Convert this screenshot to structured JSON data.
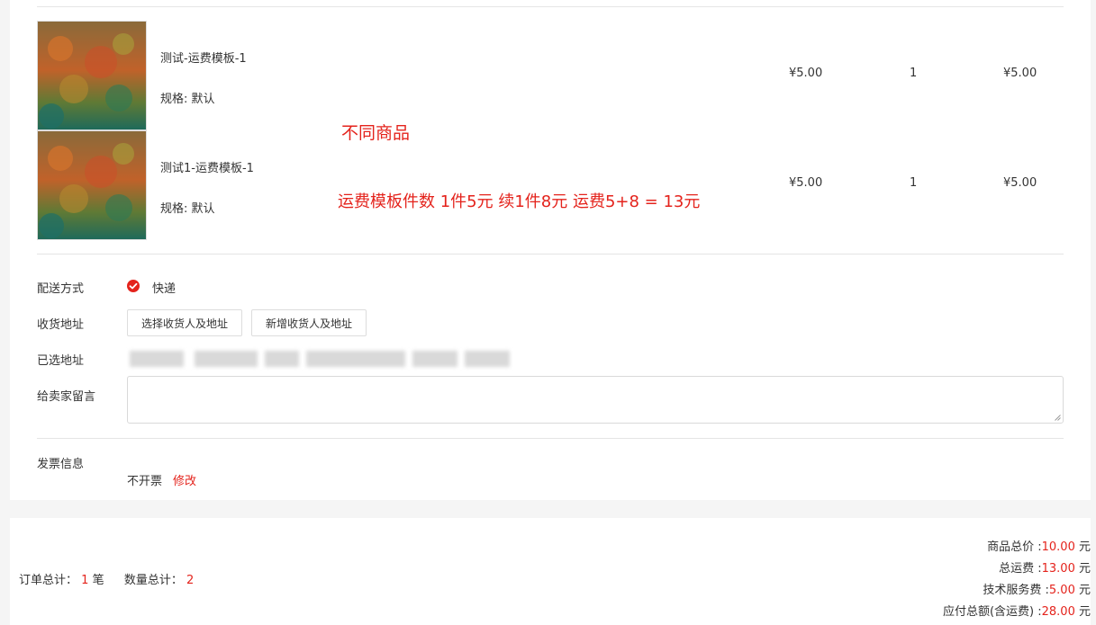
{
  "products": [
    {
      "name": "测试-运费模板-1",
      "spec": "规格: 默认",
      "price": "¥5.00",
      "qty": "1",
      "subtotal": "¥5.00"
    },
    {
      "name": "测试1-运费模板-1",
      "spec": "规格: 默认",
      "price": "¥5.00",
      "qty": "1",
      "subtotal": "¥5.00"
    }
  ],
  "annotations": {
    "line1": "不同商品",
    "line2": "运费模板件数  1件5元 续1件8元 运费5+8 = 13元"
  },
  "form": {
    "shipping_label": "配送方式",
    "shipping_value": "快递",
    "address_label": "收货地址",
    "select_address_button": "选择收货人及地址",
    "add_address_button": "新增收货人及地址",
    "selected_address_label": "已选地址",
    "message_label": "给卖家留言",
    "message_value": "",
    "invoice_label": "发票信息",
    "invoice_value": "不开票",
    "invoice_edit": "修改"
  },
  "summary": {
    "order_count_label": "订单总计：",
    "order_count": "1",
    "order_unit": "笔",
    "qty_label": "数量总计：",
    "qty": "2",
    "goods_total_label": "商品总价 :",
    "goods_total": "10.00",
    "shipping_total_label": "总运费 :",
    "shipping_total": "13.00",
    "service_fee_label": "技术服务费 :",
    "service_fee": "5.00",
    "payable_label": "应付总额(含运费) :",
    "payable": "28.00",
    "currency_unit": "元"
  },
  "colors": {
    "accent": "#e4231c",
    "border": "#e5e5e5",
    "background": "#f5f5f5"
  }
}
